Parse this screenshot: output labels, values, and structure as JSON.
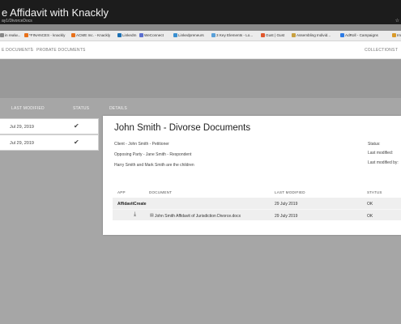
{
  "video": {
    "title": "e Affidavit with Knackly",
    "url": "ay1/DivorceDocs",
    "star": "☆"
  },
  "bookmarks": [
    {
      "label": "in realw...",
      "color": "#888888"
    },
    {
      "label": "*FINANCES - knackly",
      "color": "#e8711a"
    },
    {
      "label": "ACME Inc. - Knackly",
      "color": "#e8711a"
    },
    {
      "label": "LinkedIn",
      "color": "#1b6fb3"
    },
    {
      "label": "WeConnect",
      "color": "#5b6fcf"
    },
    {
      "label": "Linkedpreneurs",
      "color": "#3a8fd0"
    },
    {
      "label": "3 Key Elements - Lo...",
      "color": "#5aa0d8"
    },
    {
      "label": "Gust | Gust",
      "color": "#e0572c"
    },
    {
      "label": "Assembling Individ...",
      "color": "#c8a040"
    },
    {
      "label": "AdRoll - Campaigns",
      "color": "#2d7be5"
    },
    {
      "label": "Ima",
      "color": "#d99a2a"
    }
  ],
  "nav": {
    "item1": "E DOCUMENTS",
    "sep": "|",
    "item2": "PROBATE DOCUMENTS",
    "right1": "COLLECTIONS",
    "right2": "T"
  },
  "list": {
    "col_last_modified": "LAST MODIFIED",
    "col_status": "STATUS",
    "col_details": "DETAILS",
    "rows": [
      {
        "date": "Jul 29, 2019",
        "status": "✔"
      },
      {
        "date": "Jul 29, 2019",
        "status": "✔"
      }
    ]
  },
  "card": {
    "title": "John Smith - Divorse Documents",
    "client": "Client - John Smith - Petitioner",
    "opposing": "Opposing Party - Jane Smith - Respondent",
    "children": "Harry Smith and Mark Smith are the children",
    "meta_status": "Status:",
    "meta_last_modified": "Last modified:",
    "meta_last_modified_by": "Last modified by:",
    "table": {
      "headers": {
        "app": "APP",
        "document": "DOCUMENT",
        "last_modified": "LAST MODIFIED",
        "status": "STATUS"
      },
      "app_row": {
        "app": "AffidavitCreate",
        "last_modified": "29 July 2019",
        "status": "OK"
      },
      "doc_row": {
        "document": "John Smith Affidavit of Jurisdiction Divorce.docx",
        "last_modified": "29 July 2019",
        "status": "OK"
      }
    }
  }
}
